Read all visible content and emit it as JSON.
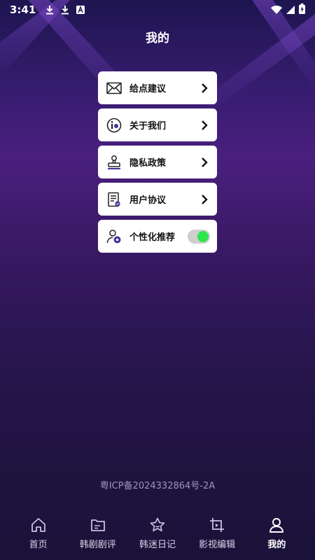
{
  "status_bar": {
    "time": "3:41",
    "left_icons": [
      "download-icon",
      "download-icon",
      "text-a-icon"
    ],
    "right_icons": [
      "wifi-icon",
      "signal-icon",
      "battery-icon"
    ]
  },
  "page": {
    "title": "我的"
  },
  "menu": {
    "items": [
      {
        "label": "给点建议",
        "icon": "mail-icon",
        "trailing": "chevron"
      },
      {
        "label": "关于我们",
        "icon": "info-icon",
        "trailing": "chevron"
      },
      {
        "label": "隐私政策",
        "icon": "stamp-icon",
        "trailing": "chevron"
      },
      {
        "label": "用户协议",
        "icon": "document-icon",
        "trailing": "chevron"
      },
      {
        "label": "个性化推荐",
        "icon": "user-settings-icon",
        "trailing": "toggle",
        "toggle_on": true
      }
    ]
  },
  "footer": {
    "icp": "粤ICP备2024332864号-2A"
  },
  "tabbar": {
    "tabs": [
      {
        "label": "首页",
        "icon": "home-icon",
        "active": false
      },
      {
        "label": "韩剧剧评",
        "icon": "folder-icon",
        "active": false
      },
      {
        "label": "韩迷日记",
        "icon": "star-icon",
        "active": false
      },
      {
        "label": "影视编辑",
        "icon": "video-edit-icon",
        "active": false
      },
      {
        "label": "我的",
        "icon": "profile-icon",
        "active": true
      }
    ]
  },
  "colors": {
    "background_top": "#1d1550",
    "background_mid": "#4a1f7e",
    "background_bottom": "#1a1238",
    "toggle_on": "#2ee64a",
    "card": "#ffffff"
  }
}
